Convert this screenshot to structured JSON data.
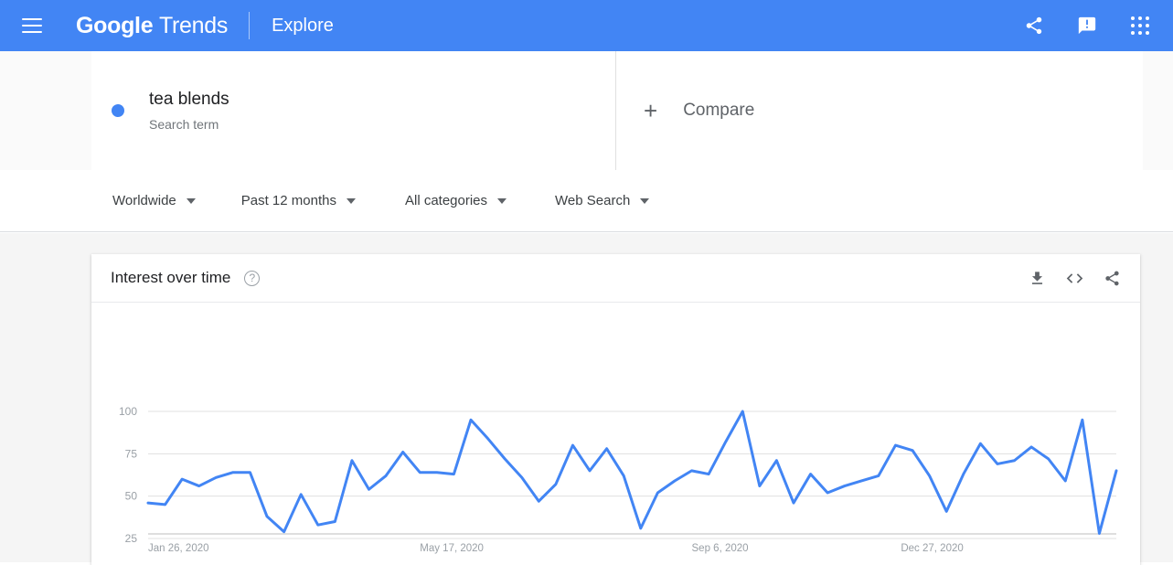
{
  "appbar": {
    "menu_label": "Main menu",
    "brand_bold": "Google",
    "brand_light": "Trends",
    "explore_label": "Explore",
    "share_icon": "share-icon",
    "feedback_icon": "feedback-icon",
    "apps_icon": "apps-grid-icon",
    "background_color": "#4285f4"
  },
  "terms": {
    "items": [
      {
        "dot_color": "#4285f4",
        "title": "tea blends",
        "subtitle": "Search term"
      }
    ],
    "compare": {
      "plus": "+",
      "label": "Compare"
    }
  },
  "filters": [
    {
      "label": "Worldwide"
    },
    {
      "label": "Past 12 months"
    },
    {
      "label": "All categories"
    },
    {
      "label": "Web Search"
    }
  ],
  "card": {
    "title": "Interest over time",
    "help": "?",
    "actions": [
      {
        "name": "download-icon"
      },
      {
        "name": "embed-icon"
      },
      {
        "name": "share-icon"
      }
    ]
  },
  "chart_data": {
    "type": "line",
    "title": "Interest over time",
    "xlabel": "",
    "ylabel": "",
    "ylim": [
      0,
      107
    ],
    "yticks": [
      25,
      50,
      75,
      100
    ],
    "ytick_labels": [
      "25",
      "50",
      "75",
      "100"
    ],
    "grid": true,
    "legend": false,
    "line_color": "#4285f4",
    "x_tick_labels": [
      "Jan 26, 2020",
      "May 17, 2020",
      "Sep 6, 2020",
      "Dec 27, 2020"
    ],
    "x_tick_indices": [
      0,
      16,
      32,
      48
    ],
    "series": [
      {
        "name": "tea blends",
        "color": "#4285f4",
        "values": [
          46,
          45,
          60,
          56,
          61,
          64,
          64,
          38,
          29,
          51,
          33,
          35,
          71,
          54,
          62,
          76,
          64,
          64,
          63,
          95,
          84,
          72,
          61,
          47,
          57,
          80,
          65,
          78,
          62,
          31,
          52,
          59,
          65,
          63,
          82,
          100,
          56,
          71,
          46,
          63,
          52,
          56,
          59,
          62,
          80,
          77,
          62,
          41,
          63,
          81,
          69,
          71,
          79,
          72,
          59,
          95,
          28,
          65
        ]
      }
    ]
  }
}
